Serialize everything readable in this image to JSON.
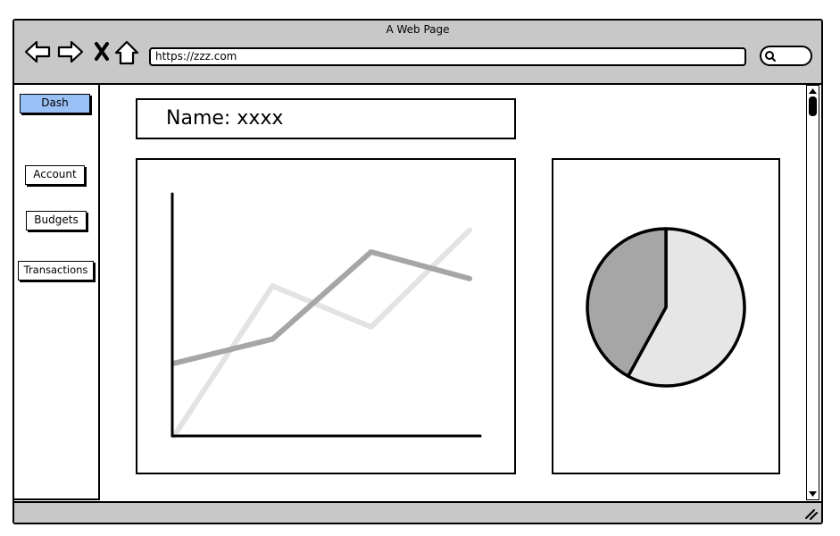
{
  "window": {
    "title": "A Web Page"
  },
  "browser": {
    "url": "https://zzz.com",
    "nav_icons": [
      "back-arrow-icon",
      "forward-arrow-icon",
      "close-x-icon",
      "home-icon"
    ],
    "search_icon": "search-icon"
  },
  "sidebar": {
    "items": [
      {
        "label": "Dash",
        "active": true
      },
      {
        "label": "Account",
        "active": false
      },
      {
        "label": "Budgets",
        "active": false
      },
      {
        "label": "Transactions",
        "active": false
      }
    ],
    "active_color": "#9ac1f5"
  },
  "profile": {
    "name_label": "Name: xxxx"
  },
  "chart_data": [
    {
      "type": "line",
      "x": [
        0,
        1,
        2,
        3
      ],
      "series": [
        {
          "values": [
            3,
            4,
            7.6,
            6.5
          ],
          "color": "#a6a6a6"
        },
        {
          "values": [
            0,
            6.2,
            4.5,
            8.5
          ],
          "color": "#e3e3e3"
        }
      ],
      "ylim": [
        0,
        10
      ],
      "grid": false
    },
    {
      "type": "pie",
      "slices": [
        {
          "value": 58,
          "color": "#e6e6e6"
        },
        {
          "value": 42,
          "color": "#a6a6a6"
        }
      ]
    }
  ],
  "colors": {
    "chrome": "#c8c8c8",
    "border": "#000000"
  }
}
